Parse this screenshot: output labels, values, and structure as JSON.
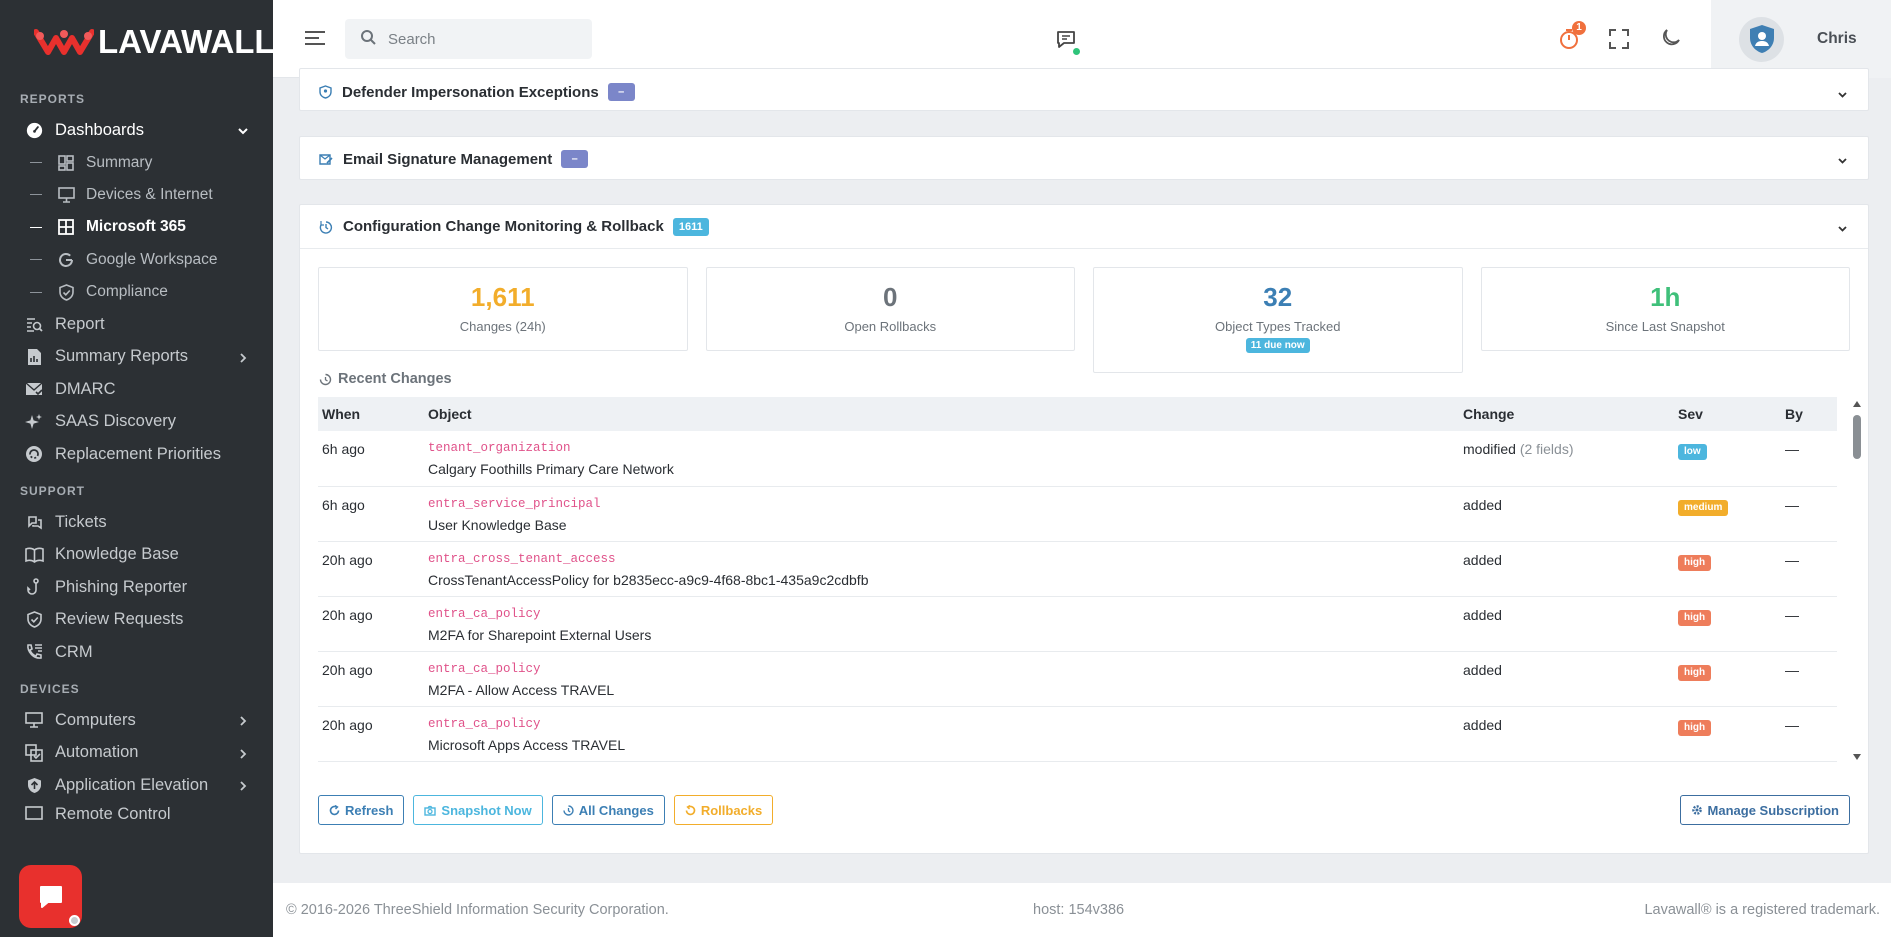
{
  "brand": {
    "name": "LAVAWALL",
    "reg": "®"
  },
  "sidebar": {
    "sections": {
      "reports": "REPORTS",
      "support": "SUPPORT",
      "devices": "DEVICES"
    },
    "reports": [
      {
        "label": "Dashboards",
        "icon": "dashboard-gauge-icon"
      },
      {
        "label": "Report",
        "icon": "report-search-icon"
      },
      {
        "label": "Summary Reports",
        "icon": "file-report-icon"
      },
      {
        "label": "DMARC",
        "icon": "mail-check-icon"
      },
      {
        "label": "SAAS Discovery",
        "icon": "sparkle-icon"
      },
      {
        "label": "Replacement Priorities",
        "icon": "circle-priority-icon"
      }
    ],
    "dash_sub": [
      {
        "label": "Summary",
        "icon": "grid-icon"
      },
      {
        "label": "Devices & Internet",
        "icon": "monitor-icon"
      },
      {
        "label": "Microsoft 365",
        "icon": "windows-icon"
      },
      {
        "label": "Google Workspace",
        "icon": "google-icon"
      },
      {
        "label": "Compliance",
        "icon": "shield-check-icon"
      }
    ],
    "support": [
      {
        "label": "Tickets",
        "icon": "ticket-icon"
      },
      {
        "label": "Knowledge Base",
        "icon": "book-icon"
      },
      {
        "label": "Phishing Reporter",
        "icon": "hook-icon"
      },
      {
        "label": "Review Requests",
        "icon": "shield-review-icon"
      },
      {
        "label": "CRM",
        "icon": "phone-book-icon"
      }
    ],
    "devices": [
      {
        "label": "Computers",
        "icon": "computer-icon"
      },
      {
        "label": "Automation",
        "icon": "automation-icon"
      },
      {
        "label": "Application Elevation",
        "icon": "shield-elevation-icon"
      },
      {
        "label": "Remote Control",
        "icon": "remote-control-icon"
      }
    ]
  },
  "header": {
    "search_placeholder": "Search",
    "timer_badge": "1",
    "user_name": "Chris"
  },
  "panels": {
    "defender": {
      "title": "Defender Impersonation Exceptions",
      "badge": "–"
    },
    "signature": {
      "title": "Email Signature Management",
      "badge": "–"
    },
    "config": {
      "title": "Configuration Change Monitoring & Rollback",
      "badge": "1611"
    }
  },
  "stats": [
    {
      "value": "1,611",
      "label": "Changes (24h)",
      "color": "#f2ad2b"
    },
    {
      "value": "0",
      "label": "Open Rollbacks",
      "color": "#6c737a"
    },
    {
      "value": "32",
      "label": "Object Types Tracked",
      "color": "#3c7fb4",
      "extra": "11 due now"
    },
    {
      "value": "1h",
      "label": "Since Last Snapshot",
      "color": "#3fc07a"
    }
  ],
  "recent": {
    "title": "Recent Changes",
    "columns": {
      "when": "When",
      "object": "Object",
      "change": "Change",
      "sev": "Sev",
      "by": "By"
    },
    "rows": [
      {
        "when": "6h ago",
        "type": "tenant_organization",
        "name": "Calgary Foothills Primary Care Network",
        "change": "modified",
        "detail": "(2 fields)",
        "sev": "low",
        "by": "—"
      },
      {
        "when": "6h ago",
        "type": "entra_service_principal",
        "name": "User Knowledge Base",
        "change": "added",
        "detail": "",
        "sev": "medium",
        "by": "—"
      },
      {
        "when": "20h ago",
        "type": "entra_cross_tenant_access",
        "name": "CrossTenantAccessPolicy for b2835ecc-a9c9-4f68-8bc1-435a9c2cdbfb",
        "change": "added",
        "detail": "",
        "sev": "high",
        "by": "—"
      },
      {
        "when": "20h ago",
        "type": "entra_ca_policy",
        "name": "M2FA for Sharepoint External Users",
        "change": "added",
        "detail": "",
        "sev": "high",
        "by": "—"
      },
      {
        "when": "20h ago",
        "type": "entra_ca_policy",
        "name": "M2FA - Allow Access TRAVEL",
        "change": "added",
        "detail": "",
        "sev": "high",
        "by": "—"
      },
      {
        "when": "20h ago",
        "type": "entra_ca_policy",
        "name": "Microsoft Apps Access TRAVEL",
        "change": "added",
        "detail": "",
        "sev": "high",
        "by": "—"
      }
    ]
  },
  "buttons": {
    "refresh": "Refresh",
    "snapshot": "Snapshot Now",
    "all": "All Changes",
    "rollbacks": "Rollbacks",
    "manage": "Manage Subscription"
  },
  "footer": {
    "copyright": "© 2016-2026 ThreeShield Information Security Corporation.",
    "host": "host: 154v386",
    "trademark": "Lavawall® is a registered trademark."
  },
  "colors": {
    "sidebar_bg": "#2c3034",
    "accent_red": "#e8302d",
    "badge_purple": "#7b86c9",
    "badge_teal": "#4cb6de"
  }
}
